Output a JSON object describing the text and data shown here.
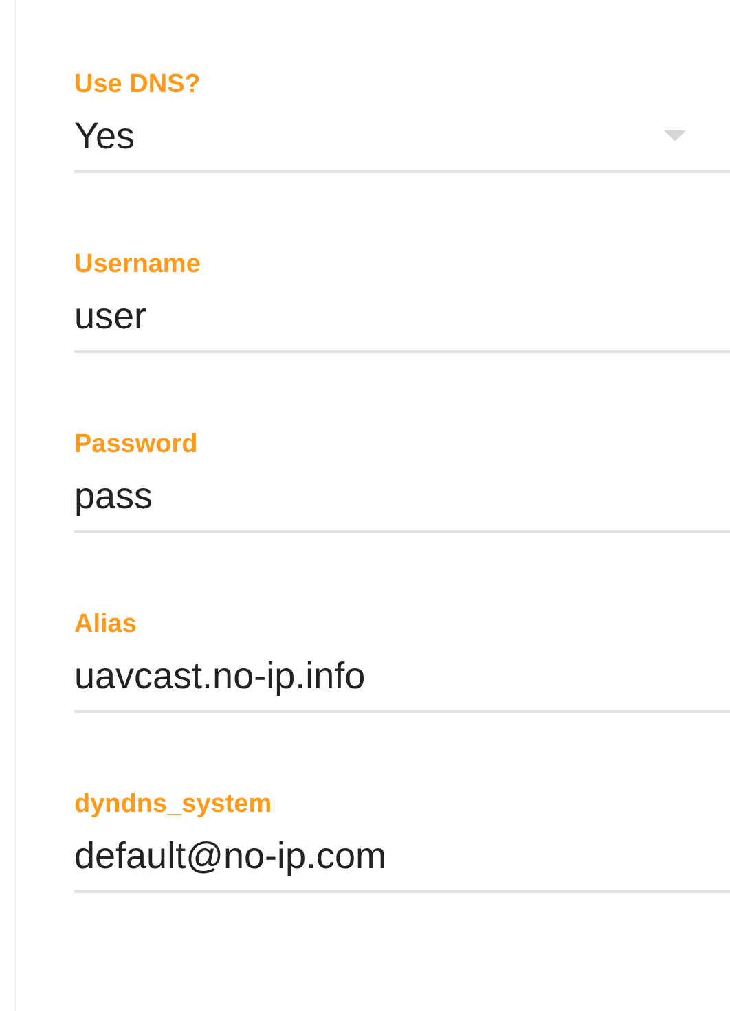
{
  "fields": [
    {
      "kind": "select",
      "label": "Use DNS?",
      "value": "Yes"
    },
    {
      "kind": "text",
      "label": "Username",
      "value": "user"
    },
    {
      "kind": "text",
      "label": "Password",
      "value": "pass"
    },
    {
      "kind": "text",
      "label": "Alias",
      "value": "uavcast.no-ip.info"
    },
    {
      "kind": "text",
      "label": "dyndns_system",
      "value": "default@no-ip.com"
    }
  ]
}
